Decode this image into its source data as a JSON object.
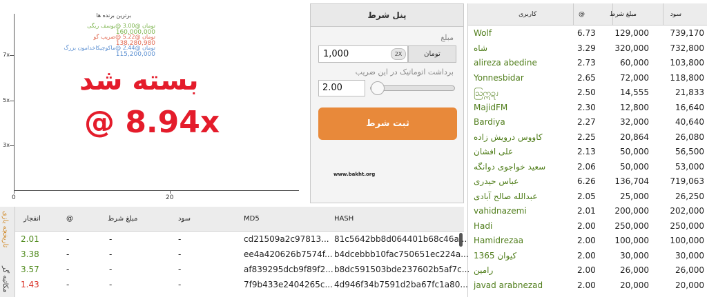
{
  "chart": {
    "y_ticks": [
      "7x",
      "5x",
      "3x"
    ],
    "x_ticks": [
      "0",
      "20"
    ]
  },
  "leaders": {
    "title": "برترین برنده ها",
    "items": [
      {
        "line": "تومان @3.00 @یوسف ریگی",
        "amount": "160,000,000",
        "color": "#7ab34a"
      },
      {
        "line": "تومان @5.22 @ضریب گو",
        "amount": "138,280,980",
        "color": "#e0674f"
      },
      {
        "line": "تومان @2.44 @ماکوچیکاخدامون بزرگ",
        "amount": "115,200,000",
        "color": "#5b8fd1"
      }
    ]
  },
  "bust": {
    "title": "بسته شد",
    "value": "@ 8.94x"
  },
  "bet_panel": {
    "title": "پنل شرط",
    "amount_label": "مبلغ",
    "amount_value": "1,000",
    "double_label": "2X",
    "currency_label": "تومان",
    "cashout_label": "برداشت اتوماتیک در این ضریب",
    "cashout_value": "2.00",
    "submit_label": "ثبت شرط",
    "site": "www.bakht.org"
  },
  "players": {
    "headers": [
      "کاربری",
      "@",
      "مبلغ شرط",
      "سود"
    ],
    "rows": [
      {
        "name": "Wolf",
        "mult": "6.73",
        "bet": "129,000",
        "profit": "739,170"
      },
      {
        "name": "شاه",
        "mult": "3.29",
        "bet": "320,000",
        "profit": "732,800"
      },
      {
        "name": "alireza abedine",
        "mult": "2.73",
        "bet": "60,000",
        "profit": "103,800"
      },
      {
        "name": "Yonnesbidar",
        "mult": "2.65",
        "bet": "72,000",
        "profit": "118,800"
      },
      {
        "name": "ဩဣဍၪ",
        "mult": "2.50",
        "bet": "14,555",
        "profit": "21,833"
      },
      {
        "name": "MajidFM",
        "mult": "2.30",
        "bet": "12,800",
        "profit": "16,640"
      },
      {
        "name": "Bardiya",
        "mult": "2.27",
        "bet": "32,000",
        "profit": "40,640"
      },
      {
        "name": "کاووس درویش زاده",
        "mult": "2.25",
        "bet": "20,864",
        "profit": "26,080"
      },
      {
        "name": "علی افشان",
        "mult": "2.13",
        "bet": "50,000",
        "profit": "56,500"
      },
      {
        "name": "سعید خواجوی دوانگه",
        "mult": "2.06",
        "bet": "50,000",
        "profit": "53,000"
      },
      {
        "name": "عباس حیدری",
        "mult": "6.26",
        "bet": "136,704",
        "profit": "719,063"
      },
      {
        "name": "عبدالله صالح آبادی",
        "mult": "2.05",
        "bet": "25,000",
        "profit": "26,250"
      },
      {
        "name": "vahidnazemi",
        "mult": "2.01",
        "bet": "200,000",
        "profit": "202,000"
      },
      {
        "name": "Hadi",
        "mult": "2.00",
        "bet": "250,000",
        "profit": "250,000"
      },
      {
        "name": "Hamidrezaa",
        "mult": "2.00",
        "bet": "100,000",
        "profit": "100,000"
      },
      {
        "name": "کیوان 1365",
        "mult": "2.00",
        "bet": "30,000",
        "profit": "30,000"
      },
      {
        "name": "رامین",
        "mult": "2.00",
        "bet": "26,000",
        "profit": "26,000"
      },
      {
        "name": "javad arabnezad",
        "mult": "2.00",
        "bet": "20,000",
        "profit": "20,000"
      }
    ]
  },
  "history": {
    "tabs": [
      "تاریخچه بازی",
      "مکاتبه گر"
    ],
    "headers": [
      "انفجار",
      "@",
      "مبلغ شرط",
      "سود",
      "MD5",
      "HASH"
    ],
    "rows": [
      {
        "crash": "2.01",
        "color": "#4f8a1c",
        "at": "-",
        "bet": "-",
        "profit": "-",
        "md5": "cd21509a2c97813...",
        "hash": "81c5642bb8d064401b68c46a..."
      },
      {
        "crash": "3.38",
        "color": "#4f8a1c",
        "at": "-",
        "bet": "-",
        "profit": "-",
        "md5": "ee4a420626b7574f...",
        "hash": "b4dcebbb10fac750651ec224a..."
      },
      {
        "crash": "3.57",
        "color": "#4f8a1c",
        "at": "-",
        "bet": "-",
        "profit": "-",
        "md5": "af839295dcb9f89f2...",
        "hash": "b8dc591503bde237602b5af7c..."
      },
      {
        "crash": "1.43",
        "color": "#d93025",
        "at": "-",
        "bet": "-",
        "profit": "-",
        "md5": "7f9b433e2404265c...",
        "hash": "4d946f34b7591d2ba67fc1a80..."
      }
    ]
  },
  "colors": {
    "accent_orange": "#e8893a",
    "bust_red": "#e41c2b",
    "win_green": "#4f7d1a"
  }
}
